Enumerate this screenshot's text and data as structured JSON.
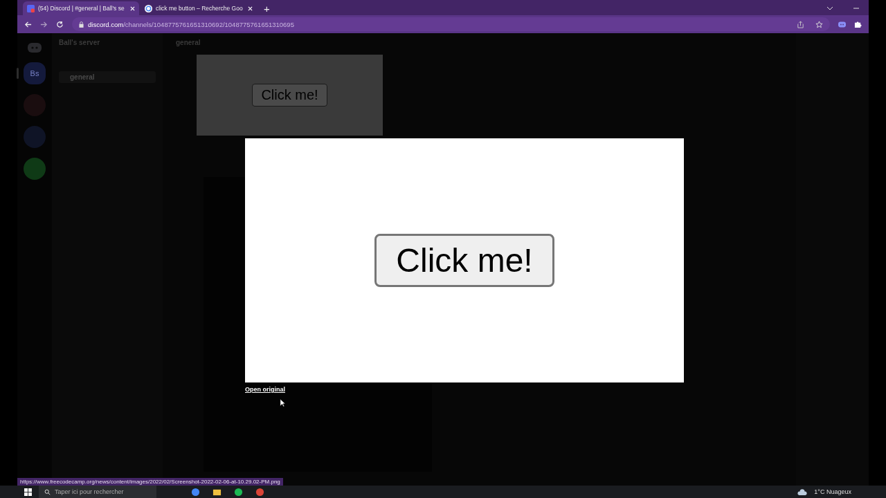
{
  "browser": {
    "tabs": [
      {
        "title": "(54) Discord | #general | Ball's se",
        "selected": true
      },
      {
        "title": "click me button – Recherche Goo",
        "selected": false
      }
    ],
    "new_tab": "+",
    "url": {
      "host": "discord.com",
      "path": "/channels/1048775761651310692/1048775761651310695"
    }
  },
  "discord": {
    "servers": [
      {
        "label": "Bs",
        "selected": true
      }
    ],
    "server_name": "Ball's server",
    "channels": [
      {
        "name": "general",
        "selected": true
      }
    ],
    "channel_header": "general",
    "embedded_image": {
      "button_label": "Click me!"
    }
  },
  "image_viewer": {
    "button_label": "Click me!",
    "link": "Open original"
  },
  "status_url": "https://www.freecodecamp.org/news/content/images/2022/02/Screenshot-2022-02-06-at-10.29.02-PM.png",
  "taskbar": {
    "search_placeholder": "Taper ici pour rechercher",
    "weather": "1°C  Nuageux"
  }
}
